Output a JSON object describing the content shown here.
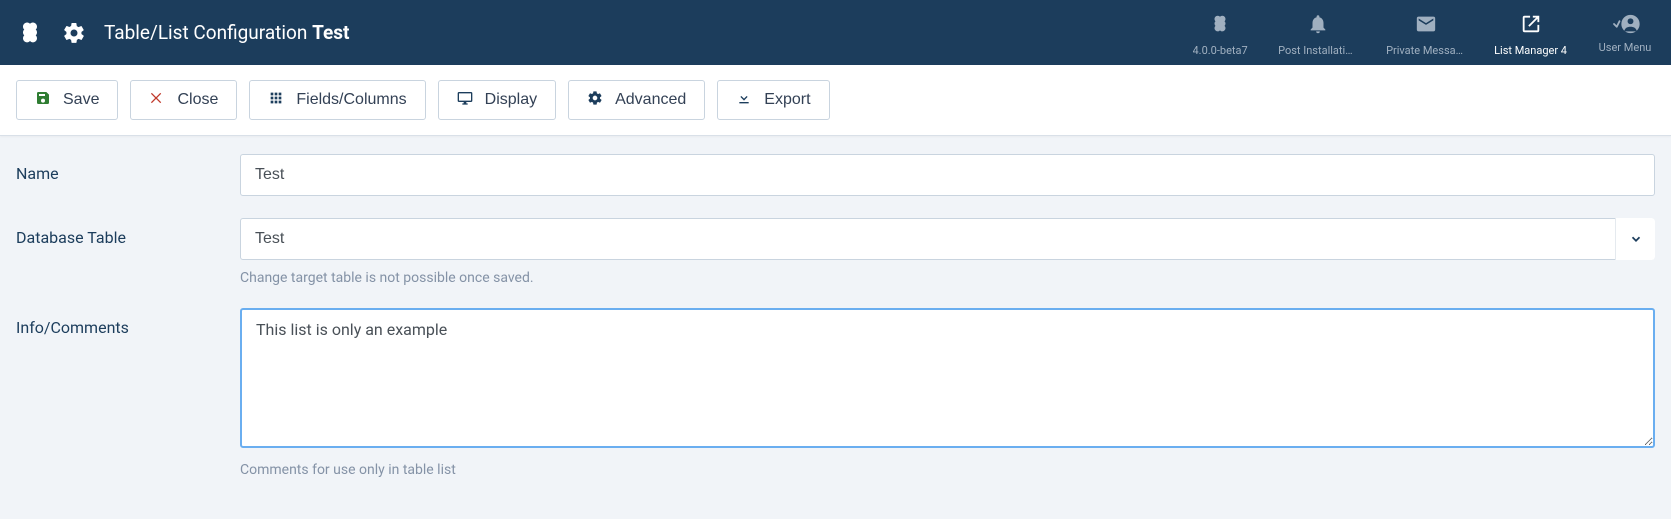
{
  "pageTitle": {
    "prefix": "Table/List Configuration ",
    "name": "Test"
  },
  "headerItems": {
    "joomlaVersion": "4.0.0-beta7",
    "postInstall": "Post Installation ...",
    "privateMessages": "Private Messages",
    "listManager": "List Manager 4",
    "userMenu": "User Menu"
  },
  "toolbar": {
    "save": "Save",
    "close": "Close",
    "fields": "Fields/Columns",
    "display": "Display",
    "advanced": "Advanced",
    "export": "Export"
  },
  "form": {
    "name": {
      "label": "Name",
      "value": "Test"
    },
    "dbTable": {
      "label": "Database Table",
      "value": "Test",
      "help": "Change target table is not possible once saved."
    },
    "comments": {
      "label": "Info/Comments",
      "value": "This list is only an example",
      "help": "Comments for use only in table list"
    }
  }
}
